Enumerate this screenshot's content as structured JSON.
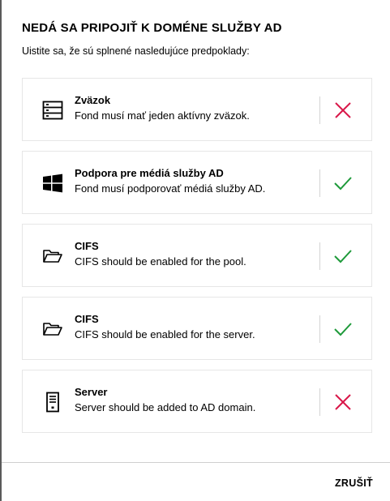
{
  "dialog": {
    "title": "NEDÁ SA PRIPOJIŤ K DOMÉNE SLUŽBY AD",
    "subtitle": "Uistite sa, že sú splnené nasledujúce predpoklady:",
    "cancel_label": "ZRUŠIŤ"
  },
  "colors": {
    "fail": "#d9184a",
    "pass": "#1e9a3a",
    "text": "#000000",
    "card_border": "#e6e6e6"
  },
  "requirements": [
    {
      "name": "Zväzok",
      "description": "Fond musí mať jeden aktívny zväzok.",
      "icon": "volume-stack-icon",
      "status": "fail"
    },
    {
      "name": "Podpora pre médiá služby AD",
      "description": "Fond musí podporovať médiá služby AD.",
      "icon": "windows-logo-icon",
      "status": "pass"
    },
    {
      "name": "CIFS",
      "description": "CIFS should be enabled for the pool.",
      "icon": "open-folder-icon",
      "status": "pass"
    },
    {
      "name": "CIFS",
      "description": "CIFS should be enabled for the server.",
      "icon": "open-folder-icon",
      "status": "pass"
    },
    {
      "name": "Server",
      "description": "Server should be added to AD domain.",
      "icon": "server-tower-icon",
      "status": "fail"
    }
  ]
}
